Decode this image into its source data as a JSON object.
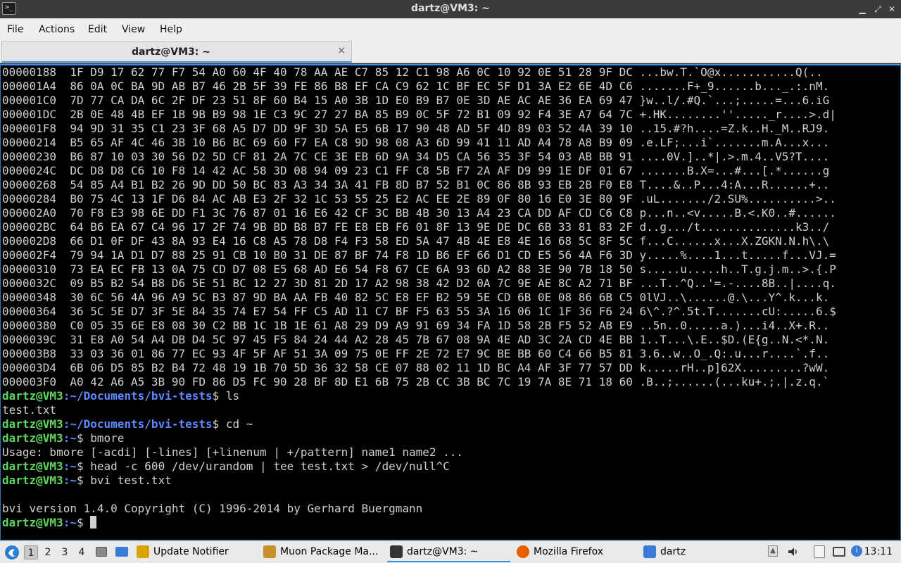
{
  "window": {
    "title": "dartz@VM3: ~",
    "icon": "terminal-icon"
  },
  "menu": [
    "File",
    "Actions",
    "Edit",
    "View",
    "Help"
  ],
  "tab": {
    "label": "dartz@VM3: ~",
    "close": "×"
  },
  "terminal": {
    "hex_lines": [
      "00000188  1F D9 17 62 77 F7 54 A0 60 4F 40 78 AA AE C7 85 12 C1 98 A6 0C 10 92 0E 51 28 9F DC ...bw.T.`O@x...........Q(..",
      "000001A4  86 0A 0C BA 9D AB B7 46 2B 5F 39 FE 86 B8 EF CA C9 62 1C BF EC 5F D1 3A E2 6E 4D C6 .......F+_9......b..._.:.nM.",
      "000001C0  7D 77 CA DA 6C 2F DF 23 51 8F 60 B4 15 A0 3B 1D E0 B9 B7 0E 3D AE AC AE 36 EA 69 47 }w..l/.#Q.`...;.....=...6.iG",
      "000001DC  2B 0E 48 4B EF 1B 9B B9 98 1E C3 9C 27 27 BA 85 B9 0C 5F 72 B1 09 92 F4 3E A7 64 7C +.HK........''....._r....>.d|",
      "000001F8  94 9D 31 35 C1 23 3F 68 A5 D7 DD 9F 3D 5A E5 6B 17 90 48 AD 5F 4D 89 03 52 4A 39 10 ..15.#?h....=Z.k..H._M..RJ9.",
      "00000214  B5 65 AF 4C 46 3B 10 B6 BC 69 60 F7 EA C8 9D 98 08 A3 6D 99 41 11 AD A4 78 A8 B9 09 .e.LF;...i`.......m.A...x...",
      "00000230  B6 87 10 03 30 56 D2 5D CF 81 2A 7C CE 3E EB 6D 9A 34 D5 CA 56 35 3F 54 03 AB BB 91 ....0V.]..*|.>.m.4..V5?T....",
      "0000024C  DC D8 D8 C6 10 F8 14 42 AC 58 3D 08 94 09 23 C1 FF C8 5B F7 2A AF D9 99 1E DF 01 67 .......B.X=...#...[.*......g",
      "00000268  54 85 A4 B1 B2 26 9D DD 50 BC 83 A3 34 3A 41 FB 8D B7 52 B1 0C 86 8B 93 EB 2B F0 E8 T....&..P...4:A...R......+..",
      "00000284  B0 75 4C 13 1F D6 84 AC AB E3 2F 32 1C 53 55 25 E2 AC EE 2E 89 0F 80 16 E0 3E 80 9F .uL......./2.SU%..........>..",
      "000002A0  70 F8 E3 98 6E DD F1 3C 76 87 01 16 E6 42 CF 3C BB 4B 30 13 A4 23 CA DD AF CD C6 C8 p...n..<v.....B.<.K0..#......",
      "000002BC  64 B6 EA 67 C4 96 17 2F 74 9B BD B8 B7 FE E8 EB F6 01 8F 13 9E DE DC 6B 33 81 83 2F d..g.../t..............k3../",
      "000002D8  66 D1 0F DF 43 8A 93 E4 16 C8 A5 78 D8 F4 F3 58 ED 5A 47 4B 4E E8 4E 16 68 5C 8F 5C f...C......x...X.ZGKN.N.h\\.\\",
      "000002F4  79 94 1A D1 D7 88 25 91 CB 10 B0 31 DE 87 BF 74 F8 1D B6 EF 66 D1 CD E5 56 4A F6 3D y.....%....1...t.....f...VJ.=",
      "00000310  73 EA EC FB 13 0A 75 CD D7 08 E5 68 AD E6 54 F8 67 CE 6A 93 6D A2 88 3E 90 7B 18 50 s.....u.....h..T.g.j.m..>.{.P",
      "0000032C  09 B5 B2 54 B8 D6 5E 51 BC 12 27 3D 81 2D 17 A2 98 38 42 D2 0A 7C 9E AE 8C A2 71 BF ...T..^Q..'=.-....8B..|....q.",
      "00000348  30 6C 56 4A 96 A9 5C B3 87 9D BA AA FB 40 82 5C E8 EF B2 59 5E CD 6B 0E 08 86 6B C5 0lVJ..\\......@.\\...Y^.k...k.",
      "00000364  36 5C 5E D7 3F 5E 84 35 74 E7 54 FF C5 AD 11 C7 BF F5 63 55 3A 16 06 1C 1F 36 F6 24 6\\^.?^.5t.T.......cU:.....6.$",
      "00000380  C0 05 35 6E E8 08 30 C2 BB 1C 1B 1E 61 A8 29 D9 A9 91 69 34 FA 1D 58 2B F5 52 AB E9 ..5n..0.....a.)...i4..X+.R..",
      "0000039C  31 E8 A0 54 A4 DB D4 5C 97 45 F5 84 24 44 A2 28 45 7B 67 08 9A 4E AD 3C 2A CD 4E BB 1..T...\\.E..$D.(E{g..N.<*.N.",
      "000003B8  33 03 36 01 86 77 EC 93 4F 5F AF 51 3A 09 75 0E FF 2E 72 E7 9C BE BB 60 C4 66 B5 81 3.6..w..O_.Q:.u...r....`.f..",
      "000003D4  6B 06 D5 85 B2 B4 72 48 19 1B 70 5D 36 32 58 CE 07 88 02 11 1D BC A4 AF 3F 77 57 DD k.....rH..p]62X.........?wW.",
      "000003F0  A0 42 A6 A5 3B 90 FD 86 D5 FC 90 28 BF 8D E1 6B 75 2B CC 3B BC 7C 19 7A 8E 71 18 60 .B..;......(...ku+.;.|.z.q.`"
    ],
    "session": [
      {
        "user": "dartz@VM3",
        "path": ":~/Documents/bvi-tests",
        "cmd": "$ ls"
      },
      {
        "text": "test.txt"
      },
      {
        "user": "dartz@VM3",
        "path": ":~/Documents/bvi-tests",
        "cmd": "$ cd ~"
      },
      {
        "user": "dartz@VM3",
        "path": ":~",
        "cmd": "$ bmore"
      },
      {
        "text": "Usage: bmore [-acdi] [-lines] [+linenum | +/pattern] name1 name2 ..."
      },
      {
        "user": "dartz@VM3",
        "path": ":~",
        "cmd": "$ head -c 600 /dev/urandom | tee test.txt > /dev/null^C"
      },
      {
        "user": "dartz@VM3",
        "path": ":~",
        "cmd": "$ bvi test.txt"
      },
      {
        "text": ""
      },
      {
        "text": "bvi version 1.4.0 Copyright (C) 1996-2014 by Gerhard Buergmann"
      },
      {
        "user": "dartz@VM3",
        "path": ":~",
        "cmd": "$ ",
        "cursor": true
      }
    ]
  },
  "taskbar": {
    "workspaces": [
      "1",
      "2",
      "3",
      "4"
    ],
    "active_workspace": "1",
    "tasks": [
      {
        "label": "Update Notifier",
        "icon": "update-notifier-icon",
        "color": "#d9a400"
      },
      {
        "label": "Muon Package Ma...",
        "icon": "package-manager-icon",
        "color": "#c8902a"
      },
      {
        "label": "dartz@VM3: ~",
        "icon": "terminal-icon",
        "color": "#333333",
        "active": true
      },
      {
        "label": "Mozilla Firefox",
        "icon": "firefox-icon",
        "color": "#e66000"
      },
      {
        "label": "dartz",
        "icon": "folder-icon",
        "color": "#3a7bd5"
      }
    ],
    "clock": "13:11"
  },
  "colors": {
    "prompt_user": "#5fd75f",
    "prompt_path": "#5f87ff",
    "terminal_bg": "#000000",
    "terminal_fg": "#cfcfcf",
    "accent": "#3a8ee6"
  }
}
